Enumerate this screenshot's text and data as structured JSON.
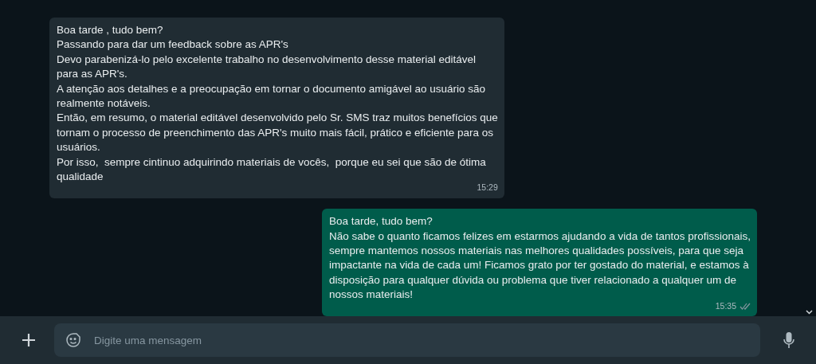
{
  "messages": [
    {
      "kind": "incoming",
      "lines": [
        "Boa tarde , tudo bem?",
        "Passando para dar um feedback sobre as APR's",
        "Devo parabenizá-lo pelo excelente trabalho no desenvolvimento desse material editável",
        "para as APR's.",
        "A atenção aos detalhes e a preocupação em tornar o documento amigável ao usuário são",
        "realmente notáveis.",
        "Então, em resumo, o material editável desenvolvido pelo Sr. SMS traz muitos benefícios que",
        "tornam o processo de preenchimento das APR's muito mais fácil, prático e eficiente para os",
        "usuários.",
        "Por isso,  sempre cintinuo adquirindo materiais de vocês,  porque eu sei que são de ótima",
        "qualidade"
      ],
      "time": "15:29"
    },
    {
      "kind": "outgoing",
      "lines": [
        "Boa tarde, tudo bem?",
        "Não sabe o quanto ficamos felizes em estarmos ajudando a vida de tantos profissionais,",
        "sempre mantemos nossos materiais nas melhores qualidades possíveis, para que seja",
        "impactante na vida de cada um! Ficamos grato por ter gostado do material, e estamos à",
        "disposição para qualquer dúvida ou problema que tiver relacionado a qualquer um de",
        "nossos materiais!"
      ],
      "time": "15:35"
    }
  ],
  "composer": {
    "placeholder": "Digite uma mensagem"
  }
}
